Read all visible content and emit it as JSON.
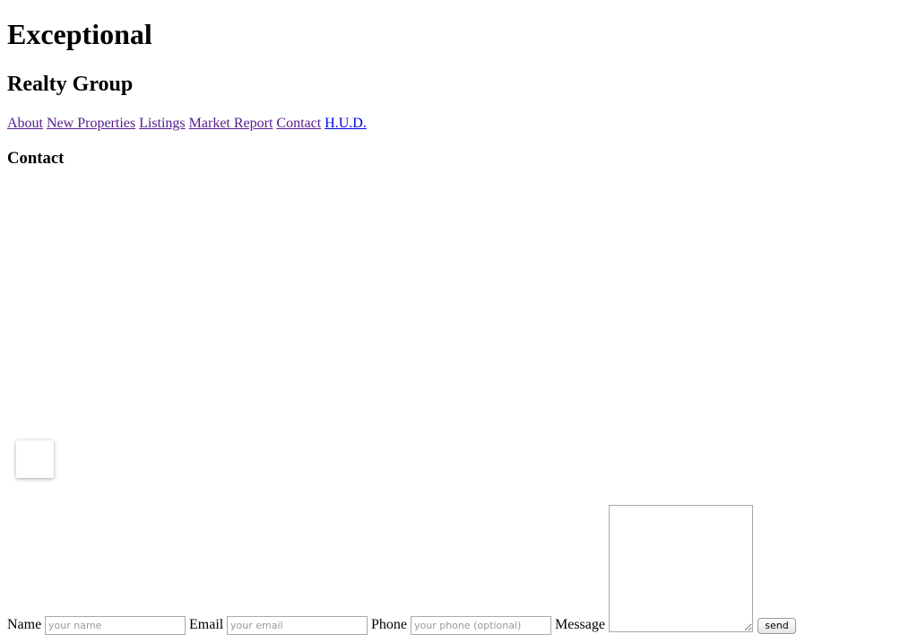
{
  "header": {
    "title": "Exceptional",
    "subtitle": "Realty Group"
  },
  "nav": {
    "items": [
      {
        "label": "About",
        "visited": true
      },
      {
        "label": "New Properties",
        "visited": true
      },
      {
        "label": "Listings",
        "visited": true
      },
      {
        "label": "Market Report",
        "visited": true
      },
      {
        "label": "Contact",
        "visited": true
      },
      {
        "label": "H.U.D.",
        "visited": false
      }
    ]
  },
  "main": {
    "section_heading": "Contact"
  },
  "form": {
    "name_label": "Name",
    "name_placeholder": "your name",
    "email_label": "Email",
    "email_placeholder": "your email",
    "phone_label": "Phone",
    "phone_placeholder": "your phone (optional)",
    "message_label": "Message",
    "message_value": "",
    "send_label": "send"
  },
  "colors": {
    "link_visited": "#551a8b",
    "link_unvisited": "#0000ee",
    "text": "#000000",
    "background": "#ffffff"
  }
}
